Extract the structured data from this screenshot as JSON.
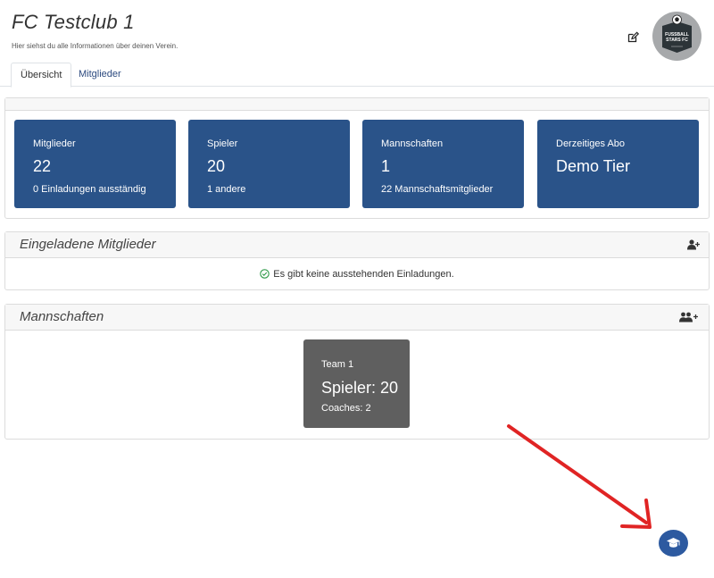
{
  "header": {
    "title": "FC Testclub 1",
    "subtitle": "Hier siehst du alle Informationen über deinen Verein."
  },
  "logo": {
    "line1": "FUSSBALL",
    "line2": "STARS FC"
  },
  "tabs": [
    {
      "label": "Übersicht",
      "active": true
    },
    {
      "label": "Mitglieder",
      "active": false
    }
  ],
  "stats": [
    {
      "label": "Mitglieder",
      "value": "22",
      "sub": "0 Einladungen ausständig"
    },
    {
      "label": "Spieler",
      "value": "20",
      "sub": "1 andere"
    },
    {
      "label": "Mannschaften",
      "value": "1",
      "sub": "22 Mannschaftsmitglieder"
    },
    {
      "label": "Derzeitiges Abo",
      "value": "Demo Tier",
      "sub": ""
    }
  ],
  "invites": {
    "title": "Eingeladene Mitglieder",
    "empty_message": "Es gibt keine ausstehenden Einladungen."
  },
  "teams": {
    "title": "Mannschaften",
    "items": [
      {
        "name": "Team 1",
        "players": "Spieler: 20",
        "coaches": "Coaches: 2"
      }
    ]
  },
  "colors": {
    "stat_bg": "#2a5389",
    "team_bg": "#5f5f5f",
    "accent_link": "#2c4a7f",
    "annotation_arrow": "#e02424",
    "help_button": "#2d5aa0"
  },
  "icons": {
    "edit": "edit-icon",
    "invite_user": "user-plus-icon",
    "add_users": "users-plus-icon",
    "ok": "check-circle-icon",
    "help": "graduation-cap-icon"
  }
}
